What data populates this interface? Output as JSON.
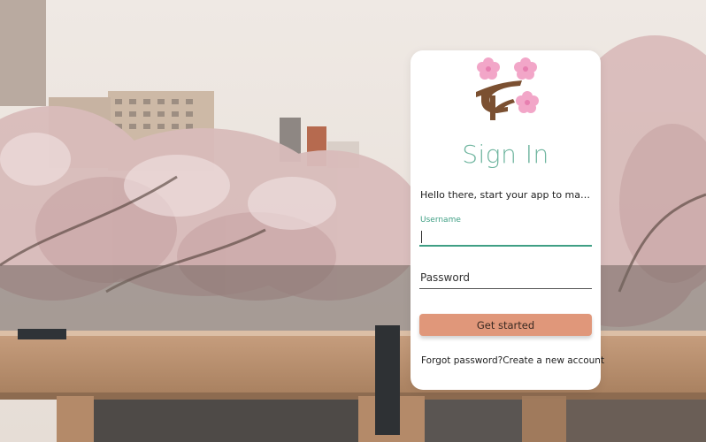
{
  "signin": {
    "title": "Sign In",
    "subtitle": "Hello there, start your app to manage ...",
    "username_label": "Username",
    "username_value": "",
    "password_placeholder": "Password",
    "password_value": "",
    "submit_label": "Get started",
    "forgot_password_label": "Forgot password?",
    "create_account_label": "Create a new account"
  },
  "icons": {
    "logo": "cherry-blossom-branch-icon"
  },
  "colors": {
    "accent": "#3f9f84",
    "title": "#6fb59f",
    "button": "#e0977a",
    "card": "#ffffff",
    "blossom": "#f2a6c8",
    "branch": "#7b5031"
  }
}
